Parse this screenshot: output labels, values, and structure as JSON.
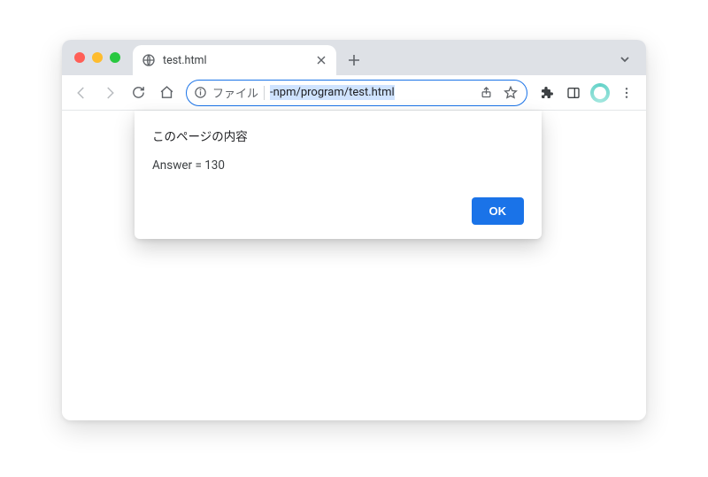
{
  "window": {
    "tab": {
      "title": "test.html"
    }
  },
  "toolbar": {
    "url_scheme_label": "ファイル",
    "url_selected_path": "-npm/program/test.html"
  },
  "alert": {
    "title": "このページの内容",
    "message": "Answer = 130",
    "ok_label": "OK"
  }
}
